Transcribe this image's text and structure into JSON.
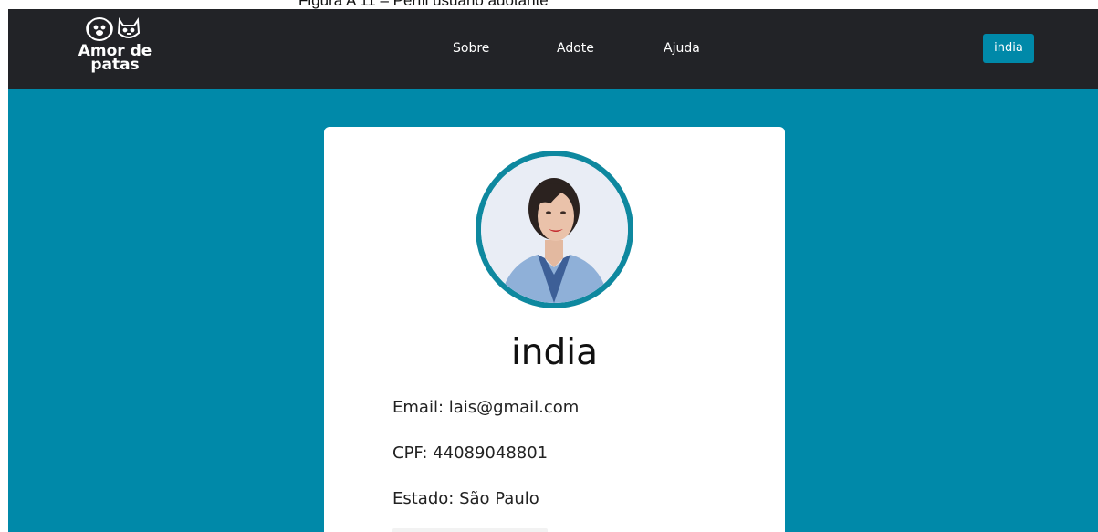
{
  "caption": "Figura A 11 – Perfil usuário adotante",
  "brand": {
    "line1": "Amor de",
    "line2": "patas"
  },
  "nav": [
    {
      "label": "Sobre"
    },
    {
      "label": "Adote"
    },
    {
      "label": "Ajuda"
    }
  ],
  "user_button": "india",
  "profile": {
    "name": "india",
    "email": "Email: lais@gmail.com",
    "cpf": "CPF: 44089048801",
    "estado": "Estado: São Paulo"
  },
  "colors": {
    "navbar": "#222327",
    "background": "#0089a9",
    "accent": "#0e889f",
    "card": "#ffffff"
  }
}
